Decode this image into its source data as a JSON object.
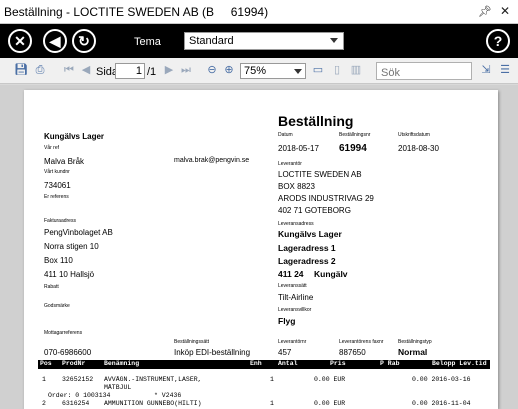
{
  "window": {
    "title": "Beställning - LOCTITE SWEDEN AB (B     61994)",
    "pin_icon": "pin-icon",
    "close_icon": "close-icon"
  },
  "topbar": {
    "tema_label": "Tema",
    "tema_value": "Standard"
  },
  "toolbar": {
    "sida_label": "Sida",
    "page_current": "1",
    "page_total": "/1",
    "zoom_value": "75%",
    "search_placeholder": "Sök"
  },
  "doc": {
    "title": "Beställning",
    "buyer_name": "Kungälvs Lager",
    "var_ref_label": "Vår ref",
    "var_ref": "Malva Bråk",
    "email": "malva.brak@pengvin.se",
    "kundnr_label": "Vårt kundnr",
    "kundnr": "734061",
    "er_ref_label": "Er referens",
    "faktura_label": "Fakturaadress",
    "faktura_name": "PengVinbolaget AB",
    "faktura_street": "Norra stigen 10",
    "faktura_box": "Box 110",
    "faktura_city": "411 10  Hallsjö",
    "rabatt_label": "Rabatt",
    "godsmarke_label": "Godsmärke",
    "mottagare_label": "Mottagarreferens",
    "mottagare": "070-6986600",
    "datum_label": "Datum",
    "datum": "2018-05-17",
    "bestnr_label": "Beställningsnr",
    "bestnr": "61994",
    "utskrift_label": "Utskriftsdatum",
    "utskrift": "2018-08-30",
    "lev_label": "Leverantör",
    "lev_name": "LOCTITE SWEDEN AB",
    "lev_box": "BOX 8823",
    "lev_street": "ARODS INDUSTRIVAG 29",
    "lev_city": "402 71  GOTEBORG",
    "levadr_label": "Leveransadress",
    "levadr_1": "Kungälvs Lager",
    "levadr_2": "Lageradress 1",
    "levadr_3": "Lageradress 2",
    "levadr_zip": "411 24",
    "levadr_city": "Kungälv",
    "levsatt_label": "Leveranssätt",
    "levsatt": "Tilt-Airline",
    "levvillkor_label": "Leveransvillkor",
    "levvillkor": "Flyg",
    "bestsatt_label": "Beställningssätt",
    "bestsatt": "Inköp EDI-beställning",
    "levnr_label": "Leverantörnr",
    "levnr": "457",
    "levfaxnr_label": "Leverantörens faxnr",
    "levfaxnr": "887650",
    "besttyp_label": "Beställningstyp",
    "besttyp": "Normal"
  },
  "table": {
    "headers": [
      "Pos",
      "ProdNr",
      "Benämning",
      "Enh",
      "Antal",
      "Pris",
      "P Rab",
      "Belopp Lev.tid"
    ],
    "rows": [
      {
        "pos": "1",
        "prodnr": "32652152",
        "ben": "AVVÄGN.-INSTRUMENT,LASER,",
        "ben2": "MÄTBJUL",
        "antal": "1",
        "pris": "0.00 EUR",
        "belopp": "0.00 2016-03-16",
        "order": "Order: 0  1003134",
        "order2": "* V2436"
      },
      {
        "pos": "2",
        "prodnr": "6316254",
        "ben": "AMMUNITION GUNNEBO(HILTI)",
        "antal": "1",
        "pris": "0.00 EUR",
        "belopp": "0.00 2016-11-04"
      }
    ]
  }
}
